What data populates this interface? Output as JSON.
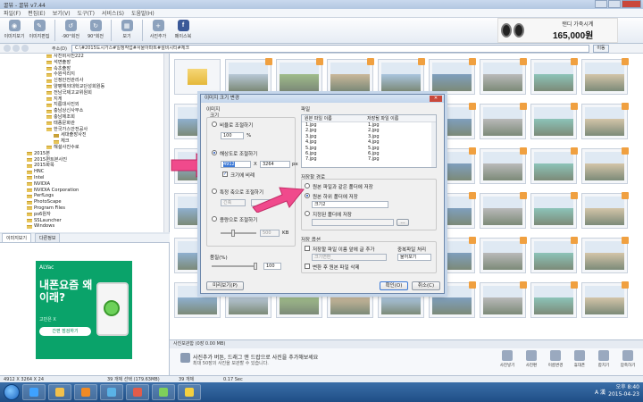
{
  "window": {
    "title": "꿀뷰 - 꿀뷰 v7.44"
  },
  "menu": [
    "파일(F)",
    "편집(E)",
    "보기(V)",
    "도구(T)",
    "서비스(S)",
    "도움말(H)"
  ],
  "toolbar": {
    "buttons": [
      {
        "label": "이미지보기",
        "icon": "eye-icon"
      },
      {
        "label": "이미지편집",
        "icon": "edit-icon"
      },
      {
        "label": "-90°회전",
        "icon": "rotate-left-icon"
      },
      {
        "label": "90°회전",
        "icon": "rotate-right-icon"
      },
      {
        "label": "보기",
        "icon": "view-icon"
      },
      {
        "label": "사진추가",
        "icon": "photo-add-icon"
      },
      {
        "label": "페이스북",
        "icon": "facebook-icon"
      }
    ]
  },
  "ad": {
    "line1": "탠디 가죽시계",
    "price": "165,000원"
  },
  "address": {
    "label": "주소(D)",
    "path": "C:\\#2015도시가스#일정작업#서울아파트#설비시티#체크",
    "go": "이동"
  },
  "tree": {
    "items": [
      "사진비사진222",
      "석면출장",
      "속초출장",
      "수원석리지",
      "신정안전관리사",
      "양평해외대학교단성회원동",
      "전남국제고교위원회",
      "지게",
      "지름대사진외",
      "충남상신사무소",
      "충남제조회",
      "태종문화관",
      "한국가스안전공사",
      "세대출장사진",
      "체크",
      "해설사진수로",
      "2015본",
      "2015편트본사진",
      "2015화목",
      "HNC",
      "Intel",
      "NVIDIA",
      "NVIDIA Corporation",
      "PerfLogs",
      "PhotoScape",
      "Program Files",
      "ps6원자",
      "SSLauncher",
      "Windows"
    ]
  },
  "left_tabs": [
    "이미지보기",
    "다른정보"
  ],
  "banner": {
    "brand": "ALYac",
    "headline": "내폰요즘 왜이래?",
    "sub": "고민은 X",
    "cta": "간편 점검하기"
  },
  "thumb_caption": "크기2",
  "dialog": {
    "title": "이미지 크기 변경",
    "section_image": "이미지",
    "size_label": "크기",
    "opt_ratio": "비율로 조절하기",
    "ratio_value": "100",
    "ratio_unit": "%",
    "opt_resolution": "해상도로 조절하기",
    "width": "4912",
    "height": "3264",
    "px": "px",
    "x": "X",
    "keep_ratio": "크기에 비례",
    "opt_side": "특정 축으로 조절하기",
    "side_value": "긴축",
    "opt_capacity": "용량으로 조절하기",
    "capacity_value": "500",
    "capacity_unit": "KB",
    "quality_label": "품질(%)",
    "quality_value": "100",
    "preview_button": "미리보기(P)",
    "section_file": "파일",
    "col_original": "원본 파일 이름",
    "col_new": "저장될 파일 이름",
    "files": [
      [
        "1.jpg",
        "1.jpg"
      ],
      [
        "2.jpg",
        "2.jpg"
      ],
      [
        "3.jpg",
        "3.jpg"
      ],
      [
        "4.jpg",
        "4.jpg"
      ],
      [
        "5.jpg",
        "5.jpg"
      ],
      [
        "6.jpg",
        "6.jpg"
      ],
      [
        "7.jpg",
        "7.jpg"
      ]
    ],
    "section_path": "저장할 경로",
    "opt_same_folder": "원본 파일과 같은 폴더에 저장",
    "opt_subfolder": "원본 하위 폴더에 저장",
    "subfolder_name": "크기2",
    "opt_custom_folder": "지정된 폴더에 저장",
    "section_options": "저장 옵션",
    "add_suffix": "저장할 파일 이름 앞에 글 추가",
    "suffix_value": "크기변환_",
    "dup_label": "중복파일 처리",
    "dup_value": "물어보기",
    "delete_after": "변환 후 원본 파일 삭제",
    "ok": "확인(O)",
    "cancel": "취소(C)"
  },
  "bottom": {
    "header": "사진보관함 (0장 0.00 MB)",
    "msg1": "사진추가 버튼, 드래그 앤 드랍으로 사진을 추가해보세요",
    "msg2": "최대 50장의 사진을 보관할 수 있습니다.",
    "tools": [
      "사진넣기",
      "사진편",
      "이름변경",
      "휴대폰",
      "합치기",
      "압축하기"
    ]
  },
  "status": {
    "dims": "4912 X 3264 X 24",
    "count": "39 개체 선택 (179.63MB)",
    "size": "39 개체",
    "time": "0.17 Sec"
  },
  "taskbar": {
    "time": "오후 8:40",
    "date": "2015-04-23",
    "lang": "A 漢"
  }
}
